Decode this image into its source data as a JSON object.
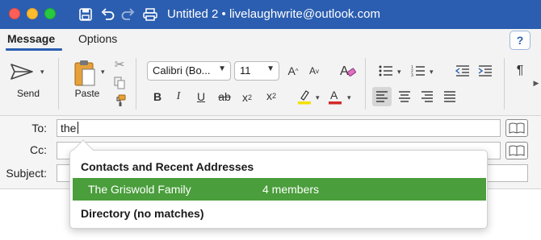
{
  "window": {
    "title": "Untitled 2 • livelaughwrite@outlook.com",
    "title_bar_color": "#2b5eb0"
  },
  "toolbar_icons": [
    "save-icon",
    "undo-icon",
    "redo-icon",
    "print-icon"
  ],
  "tabs": [
    {
      "label": "Message",
      "active": true
    },
    {
      "label": "Options",
      "active": false
    }
  ],
  "help_label": "?",
  "ribbon": {
    "send_label": "Send",
    "paste_label": "Paste",
    "font_name": "Calibri (Bo...",
    "font_size": "11",
    "format_buttons": {
      "bold": "B",
      "italic": "I",
      "underline": "U",
      "strike": "ab",
      "subscript": "x",
      "superscript": "x"
    },
    "highlight_color": "#f5e000",
    "font_color": "#d42a2a",
    "paragraph_mark": "¶"
  },
  "address": {
    "to_label": "To:",
    "to_value": "the",
    "cc_label": "Cc:",
    "cc_value": "",
    "subject_label": "Subject:",
    "subject_value": ""
  },
  "autocomplete": {
    "section_contacts": "Contacts and Recent Addresses",
    "items": [
      {
        "name": "The Griswold Family",
        "detail": "4 members",
        "selected": true
      }
    ],
    "section_directory": "Directory (no matches)",
    "selected_color": "#4a9e3b"
  }
}
